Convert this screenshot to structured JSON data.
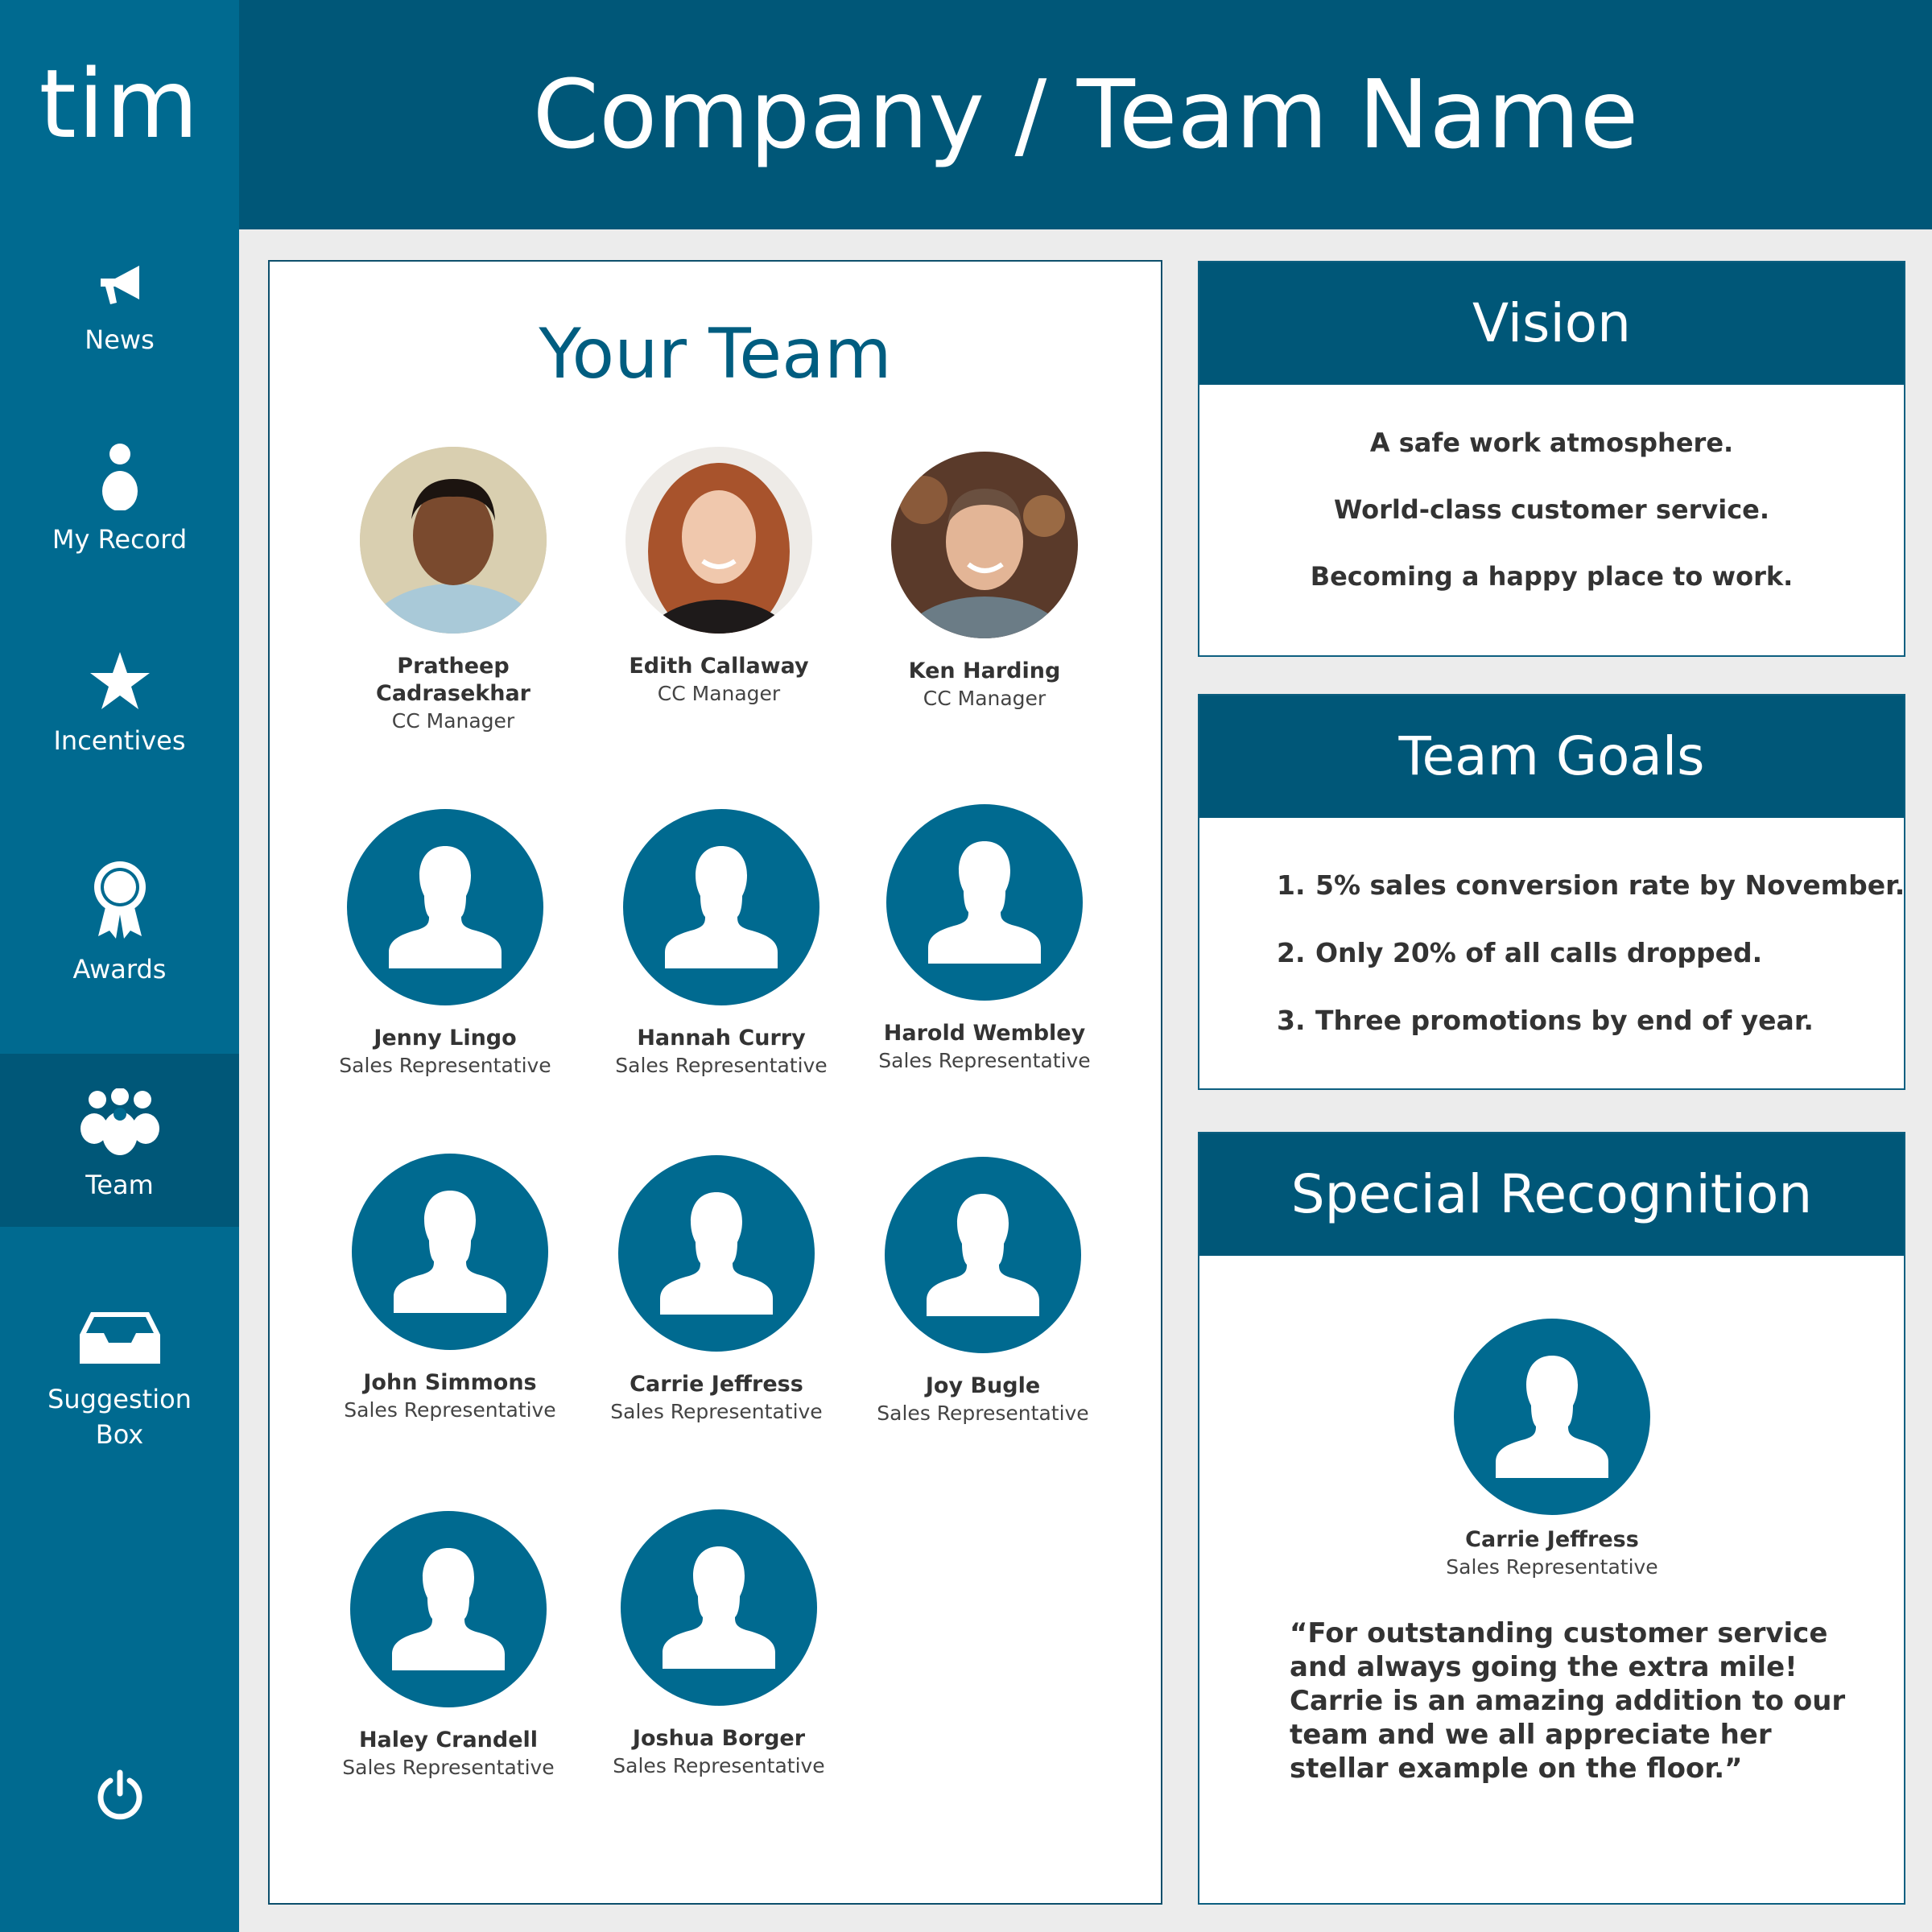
{
  "app": {
    "logo": "tim",
    "title": "Company / Team Name"
  },
  "sidebar": {
    "items": [
      {
        "label": "News",
        "icon": "megaphone-icon"
      },
      {
        "label": "My Record",
        "icon": "person-icon"
      },
      {
        "label": "Incentives",
        "icon": "star-icon"
      },
      {
        "label": "Awards",
        "icon": "award-ribbon-icon"
      },
      {
        "label": "Team",
        "icon": "team-icon",
        "active": true
      },
      {
        "label": "Suggestion",
        "label2": "Box",
        "icon": "inbox-icon"
      }
    ],
    "power_icon": "power-icon"
  },
  "team": {
    "title": "Your Team",
    "managers": [
      {
        "name_line1": "Pratheep",
        "name_line2": "Cadrasekhar",
        "role": "CC Manager"
      },
      {
        "name": "Edith Callaway",
        "role": "CC Manager"
      },
      {
        "name": "Ken Harding",
        "role": "CC Manager"
      }
    ],
    "members": [
      {
        "name": "Jenny Lingo",
        "role": "Sales Representative"
      },
      {
        "name": "Hannah Curry",
        "role": "Sales Representative"
      },
      {
        "name": "Harold Wembley",
        "role": "Sales Representative"
      },
      {
        "name": "John Simmons",
        "role": "Sales Representative"
      },
      {
        "name": "Carrie Jeffress",
        "role": "Sales Representative"
      },
      {
        "name": "Joy Bugle",
        "role": "Sales Representative"
      },
      {
        "name": "Haley Crandell",
        "role": "Sales Representative"
      },
      {
        "name": "Joshua Borger",
        "role": "Sales Representative"
      }
    ]
  },
  "vision": {
    "title": "Vision",
    "lines": [
      "A safe work atmosphere.",
      "World-class customer service.",
      "Becoming a happy place to work."
    ]
  },
  "goals": {
    "title": "Team Goals",
    "items": [
      {
        "num": "1.",
        "text": "5% sales conversion rate by November."
      },
      {
        "num": "2.",
        "text": "Only 20% of all calls dropped."
      },
      {
        "num": "3.",
        "text": "Three promotions by end of year."
      }
    ]
  },
  "recognition": {
    "title": "Special Recognition",
    "name": "Carrie Jeffress",
    "role": "Sales Representative",
    "quote": "“For outstanding customer service and always going the extra mile! Carrie is an amazing addition to our team and we all appreciate her stellar example on the floor.”"
  },
  "colors": {
    "sidebar": "#006a90",
    "header": "#005778",
    "accent": "#005d80",
    "avatar": "#006a90"
  }
}
